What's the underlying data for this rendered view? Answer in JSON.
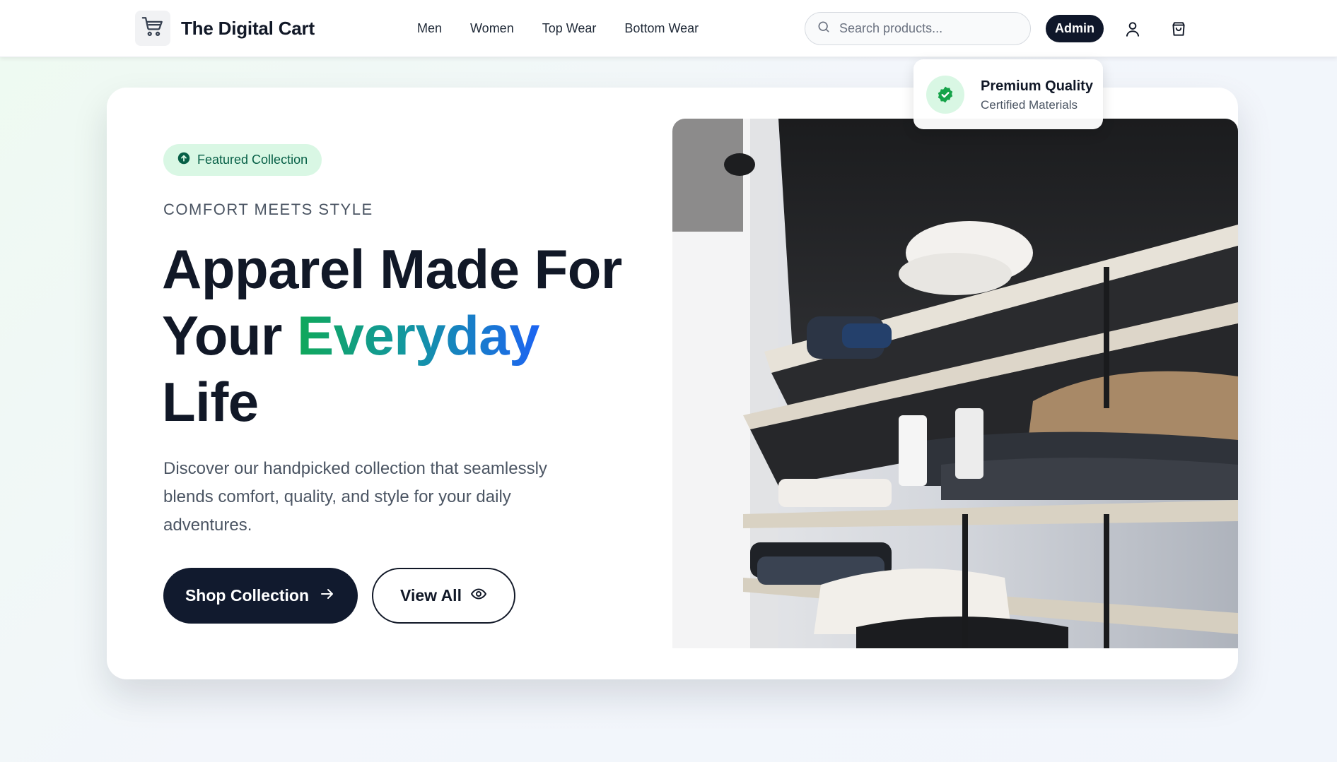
{
  "brand": {
    "name": "The Digital Cart",
    "icon": "cart-icon"
  },
  "nav": {
    "links": [
      {
        "label": "Men"
      },
      {
        "label": "Women"
      },
      {
        "label": "Top Wear"
      },
      {
        "label": "Bottom Wear"
      }
    ],
    "search": {
      "placeholder": "Search products...",
      "value": "",
      "icon": "search-icon"
    },
    "admin_label": "Admin",
    "icons": [
      "user-icon",
      "shopping-bag-icon"
    ]
  },
  "hero": {
    "badge": {
      "label": "Featured Collection",
      "icon": "arrow-up-circle-icon"
    },
    "kicker": "COMFORT MEETS STYLE",
    "headline": {
      "part1": "Apparel Made For",
      "part2": "Your",
      "accent": "Everyday",
      "part3": "Life"
    },
    "description": "Discover our handpicked collection that seamlessly blends comfort, quality, and style for your daily adventures.",
    "primary_button": {
      "label": "Shop Collection",
      "icon": "arrow-right-icon"
    },
    "secondary_button": {
      "label": "View All",
      "icon": "eye-icon"
    },
    "image_alt": "Clothing store shelves",
    "quality_card": {
      "title": "Premium Quality",
      "subtitle": "Certified Materials",
      "icon": "check-badge-icon"
    }
  },
  "colors": {
    "primary_dark": "#111a2e",
    "accent_green": "#10a85a",
    "accent_blue": "#1d64f2",
    "badge_bg": "#d9f7e4"
  }
}
